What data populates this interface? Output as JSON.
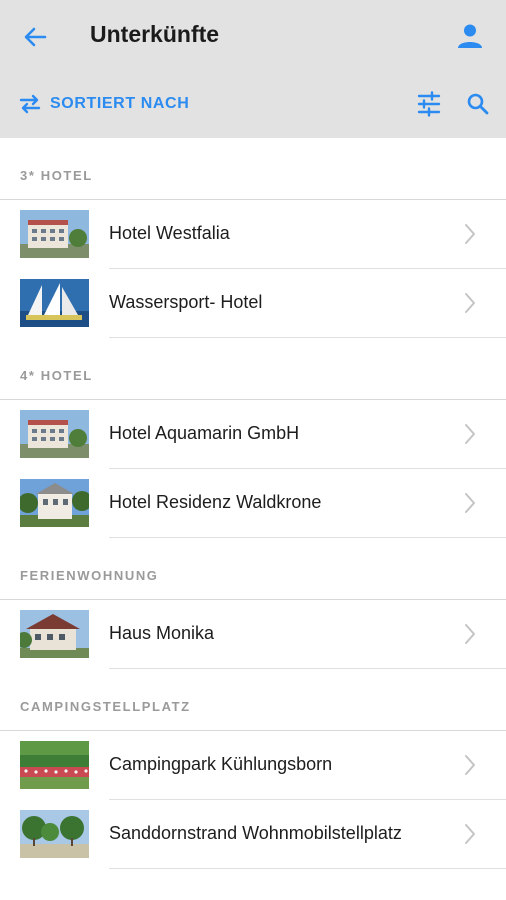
{
  "header": {
    "title": "Unterkünfte",
    "back_icon": "arrow-left-icon",
    "user_icon": "user-icon",
    "sort_label": "SORTIERT NACH",
    "sort_icon": "swap-arrows-icon",
    "filter_icon": "sliders-icon",
    "search_icon": "search-icon",
    "accent_color": "#2b8bf0",
    "bar_color": "#e2e2e2"
  },
  "sections": [
    {
      "title": "3* HOTEL",
      "items": [
        {
          "name": "Hotel Westfalia",
          "thumb": "hotel-building"
        },
        {
          "name": "Wassersport- Hotel",
          "thumb": "sailboat"
        }
      ]
    },
    {
      "title": "4* HOTEL",
      "items": [
        {
          "name": "Hotel Aquamarin GmbH",
          "thumb": "hotel-building"
        },
        {
          "name": "Hotel Residenz Waldkrone",
          "thumb": "villa"
        }
      ]
    },
    {
      "title": "FERIENWOHNUNG",
      "items": [
        {
          "name": "Haus Monika",
          "thumb": "house"
        }
      ]
    },
    {
      "title": "CAMPINGSTELLPLATZ",
      "items": [
        {
          "name": "Campingpark Kühlungsborn",
          "thumb": "garden"
        },
        {
          "name": "Sanddornstrand Wohnmobilstellplatz",
          "thumb": "trees"
        }
      ]
    }
  ]
}
